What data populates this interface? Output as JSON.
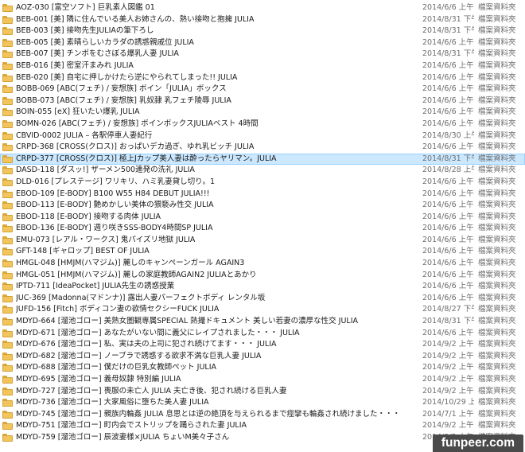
{
  "rows": [
    {
      "name": "AOZ-030 [富空ソフト] 巨乳素人図鑑 01",
      "date": "2014/6/6 上午 04...",
      "type": "檔案資料夾"
    },
    {
      "name": "BEB-001 [美] 隣に住んでいる美人お姉さんの、熱い接吻と抱擁 JULIA",
      "date": "2014/8/31 下午 0...",
      "type": "檔案資料夾"
    },
    {
      "name": "BEB-003 [美] 接吻先生JULIAの筆下ろし",
      "date": "2014/8/31 下午 0...",
      "type": "檔案資料夾"
    },
    {
      "name": "BEB-005 [美] 素晴らしいカラダの誘惑親戚位 JULIA",
      "date": "2014/6/6 上午 04...",
      "type": "檔案資料夾"
    },
    {
      "name": "BEB-007 [美] チンポをむさぼる爆乳人妻 JULIA",
      "date": "2014/8/31 下午 0...",
      "type": "檔案資料夾"
    },
    {
      "name": "BEB-016 [美] 密室汗まみれ JULIA",
      "date": "2014/6/6 上午 04...",
      "type": "檔案資料夾"
    },
    {
      "name": "BEB-020 [美] 自宅に押しかけたら逆にやられてしまった!! JULIA",
      "date": "2014/6/6 上午 04...",
      "type": "檔案資料夾"
    },
    {
      "name": "BOBB-069 [ABC(フェチ) / 妄想族] ボイン「JULIA」ボックス",
      "date": "2014/6/6 上午 04...",
      "type": "檔案資料夾"
    },
    {
      "name": "BOBB-073 [ABC(フェチ) / 妄想族] 乳奴隷 乳フェチ陵辱 JULIA",
      "date": "2014/6/6 上午 04...",
      "type": "檔案資料夾"
    },
    {
      "name": "BOIN-055 [eX] 狂いたい爆乳 JULIA",
      "date": "2014/6/6 上午 04...",
      "type": "檔案資料夾"
    },
    {
      "name": "BOMN-026 [ABC(フェチ) / 妄想族] ボインボックスJULIAベスト 4時間",
      "date": "2014/6/6 上午 04...",
      "type": "檔案資料夾"
    },
    {
      "name": "CBVID-0002 JULIA – 各駅停車人妻紀行",
      "date": "2014/8/30 上午 1...",
      "type": "檔案資料夾"
    },
    {
      "name": "CRPD-368 [CROSS(クロス)] おっぱいデカ過ぎ、ゆれ乳ビッチ JULIA",
      "date": "2014/6/6 上午 04...",
      "type": "檔案資料夾"
    },
    {
      "name": "CRPD-377 [CROSS(クロス)] 極上Jカップ美人妻は酔ったらヤリマン。JULIA",
      "date": "2014/8/31 下午 0...",
      "type": "檔案資料夾",
      "selected": true
    },
    {
      "name": "DASD-118 [ダスッ!] ザーメン500連発の洗礼 JULIA",
      "date": "2014/8/28 上午 1...",
      "type": "檔案資料夾"
    },
    {
      "name": "DLD-016 [プレステージ] ワリキリ、ハミ乳妻貸し切り。1",
      "date": "2014/6/6 上午 04...",
      "type": "檔案資料夾"
    },
    {
      "name": "EBOD-109 [E-BODY] B100 W55 H84 DEBUT JULIA!!!",
      "date": "2014/6/6 上午 04...",
      "type": "檔案資料夾"
    },
    {
      "name": "EBOD-113 [E-BODY] 艶めかしい美体の猥褻み性交 JULIA",
      "date": "2014/6/6 上午 04...",
      "type": "檔案資料夾"
    },
    {
      "name": "EBOD-118 [E-BODY] 接吻する肉体 JULIA",
      "date": "2014/6/6 上午 04...",
      "type": "檔案資料夾"
    },
    {
      "name": "EBOD-136 [E-BODY] 週り咲きSSS-BODY4時間SP JULIA",
      "date": "2014/6/6 上午 04...",
      "type": "檔案資料夾"
    },
    {
      "name": "EMU-073 [レアル・ワークス] 鬼パイズリ地獄 JULIA",
      "date": "2014/6/6 上午 04...",
      "type": "檔案資料夾"
    },
    {
      "name": "GFT-148 [ギャロップ] BEST OF JULIA",
      "date": "2014/6/6 上午 04...",
      "type": "檔案資料夾"
    },
    {
      "name": "HMGL-048 [HMJM(ハマジム)] 麗しのキャンペーンガール AGAIN3",
      "date": "2014/6/6 上午 04...",
      "type": "檔案資料夾"
    },
    {
      "name": "HMGL-051 [HMJM(ハマジム)] 麗しの家庭教師AGAIN2 JULIAとあかり",
      "date": "2014/6/6 上午 04...",
      "type": "檔案資料夾"
    },
    {
      "name": "IPTD-711 [IdeaPocket] JULIA先生の誘惑授業",
      "date": "2014/6/6 上午 04...",
      "type": "檔案資料夾"
    },
    {
      "name": "JUC-369 [Madonna(マドンナ)] 露出人妻パーフェクトボディ レンタル坂",
      "date": "2014/6/6 上午 04...",
      "type": "檔案資料夾"
    },
    {
      "name": "JUFD-156 [Fitch] ボディコン妻の欲情セクシーFUCK JULIA",
      "date": "2014/8/27 下午 0...",
      "type": "檔案資料夾"
    },
    {
      "name": "MDYD-664 [溜池ゴロー] 美熟女圏観専属SPECIAL 熱撮ドキュメント 美しい若妻の濃厚な性交 JULIA",
      "date": "2014/8/31 下午 0...",
      "type": "檔案資料夾"
    },
    {
      "name": "MDYD-671 [溜池ゴロー] あなたがいない間に義父にレイプされました・・・ JULIA",
      "date": "2014/6/6 上午 04...",
      "type": "檔案資料夾"
    },
    {
      "name": "MDYD-676 [溜池ゴロー] 私、実は夫の上司に犯され続けてます・・・ JULIA",
      "date": "2014/9/2 上午 09...",
      "type": "檔案資料夾"
    },
    {
      "name": "MDYD-682 [溜池ゴロー] ノーブラで誘惑する欲求不満な巨乳人妻 JULIA",
      "date": "2014/9/2 上午 09...",
      "type": "檔案資料夾"
    },
    {
      "name": "MDYD-688 [溜池ゴロー] 僕だけの巨乳女教師ペット JULIA",
      "date": "2014/9/2 上午 09...",
      "type": "檔案資料夾"
    },
    {
      "name": "MDYD-695 [溜池ゴロー] 義母奴隷 特別編 JULIA",
      "date": "2014/9/2 上午 09...",
      "type": "檔案資料夾"
    },
    {
      "name": "MDYD-727 [溜池ゴロー] 喪服の未亡人 JULIA 夫亡き後、犯され続ける巨乳人妻",
      "date": "2014/9/2 上午 09...",
      "type": "檔案資料夾"
    },
    {
      "name": "MDYD-736 [溜池ゴロー] 大家風俗に堕ちた美人妻 JULIA",
      "date": "2014/10/29 上午 ...",
      "type": "檔案資料夾"
    },
    {
      "name": "MDYD-745 [溜池ゴロー] 親族内輪姦 JULIA 息思とは逆の絶頂を与えられるまで痙攣も輪姦され続けました・・・",
      "date": "2014/7/1 上午 02...",
      "type": "檔案資料夾"
    },
    {
      "name": "MDYD-751 [溜池ゴロー] 町内会でストリップを踊らされた妻 JULIA",
      "date": "2014/9/2 上午 09...",
      "type": "檔案資料夾"
    },
    {
      "name": "MDYD-759 [溜池ゴロー] 辰波妻様×JULIA ちょいM美々子さん",
      "date": "2014/9/2 上午 09...",
      "type": "檔案資料夾"
    }
  ],
  "watermark": "funpeer.com"
}
